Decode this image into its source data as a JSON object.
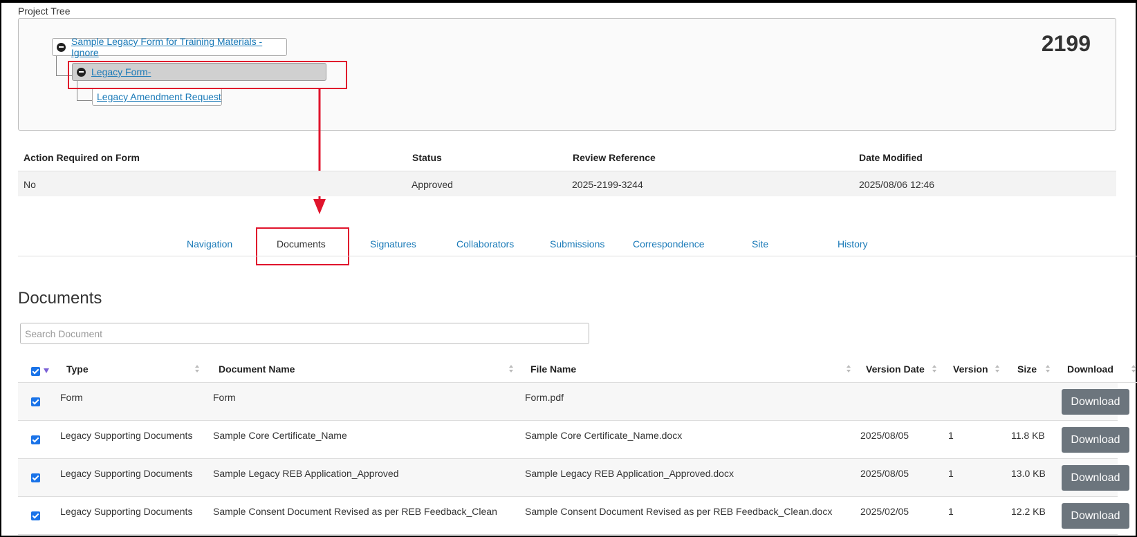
{
  "project_tree": {
    "title": "Project Tree",
    "project_number": "2199",
    "nodes": [
      {
        "label": "Sample Legacy Form for Training Materials - Ignore"
      },
      {
        "label": "Legacy Form-"
      },
      {
        "label": "Legacy Amendment Request"
      }
    ]
  },
  "info": {
    "headers": [
      "Action Required on Form",
      "Status",
      "Review Reference",
      "Date Modified"
    ],
    "values": [
      "No",
      "Approved",
      "2025-2199-3244",
      "2025/08/06 12:46"
    ]
  },
  "tabs": [
    "Navigation",
    "Documents",
    "Signatures",
    "Collaborators",
    "Submissions",
    "Correspondence",
    "Site",
    "History"
  ],
  "active_tab": "Documents",
  "documents": {
    "title": "Documents",
    "search_placeholder": "Search Document",
    "columns": [
      "Type",
      "Document Name",
      "File Name",
      "Version Date",
      "Version",
      "Size",
      "Download"
    ],
    "rows": [
      {
        "type": "Form",
        "name": "Form",
        "file": "Form.pdf",
        "date": "",
        "version": "",
        "size": "",
        "button": "Download"
      },
      {
        "type": "Legacy Supporting Documents",
        "name": "Sample Core Certificate_Name",
        "file": "Sample Core Certificate_Name.docx",
        "date": "2025/08/05",
        "version": "1",
        "size": "11.8 KB",
        "button": "Download"
      },
      {
        "type": "Legacy Supporting Documents",
        "name": "Sample Legacy REB Application_Approved",
        "file": "Sample Legacy REB Application_Approved.docx",
        "date": "2025/08/05",
        "version": "1",
        "size": "13.0 KB",
        "button": "Download"
      },
      {
        "type": "Legacy Supporting Documents",
        "name": "Sample Consent Document Revised as per REB Feedback_Clean",
        "file": "Sample Consent Document Revised as per REB Feedback_Clean.docx",
        "date": "2025/02/05",
        "version": "1",
        "size": "12.2 KB",
        "button": "Download"
      }
    ]
  },
  "colors": {
    "link": "#1a7ab8",
    "annotation": "#e0142c",
    "button": "#6c757d",
    "checkbox": "#1a73e8"
  }
}
